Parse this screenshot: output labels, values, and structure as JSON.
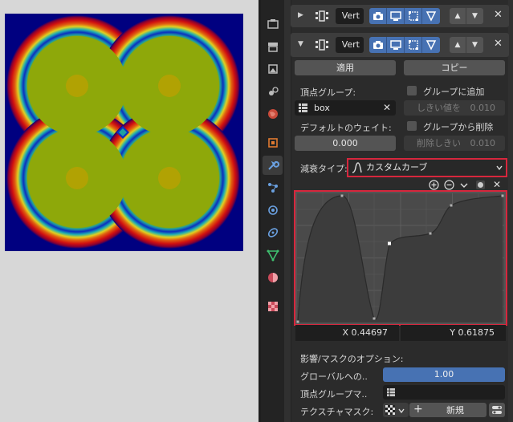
{
  "modifier_1": {
    "name": "Vert"
  },
  "modifier_2": {
    "name": "Vert"
  },
  "buttons": {
    "apply": "適用",
    "copy": "コピー",
    "new": "新規"
  },
  "vertex_group": {
    "label": "頂点グループ:",
    "value": "box",
    "add_to_group": "グループに追加",
    "threshold_label": "しきい値を",
    "threshold_value": "0.010"
  },
  "default_weight": {
    "label": "デフォルトのウェイト:",
    "value": "0.000",
    "remove_from_group": "グループから削除",
    "remove_threshold_label": "削除しきい",
    "remove_threshold_value": "0.010"
  },
  "falloff": {
    "label": "減衰タイプ:",
    "value": "カスタムカーブ"
  },
  "curve": {
    "x_label": "X 0.44697",
    "y_label": "Y 0.61875"
  },
  "influence": {
    "title": "影響/マスクのオプション:",
    "global_label": "グローバルへの..",
    "global_value": "1.00",
    "vgroup_mask_label": "頂点グループマ..",
    "texture_mask_label": "テクスチャマスク:"
  },
  "colors": {
    "accent": "#4772b3",
    "highlight": "#d7263d"
  }
}
